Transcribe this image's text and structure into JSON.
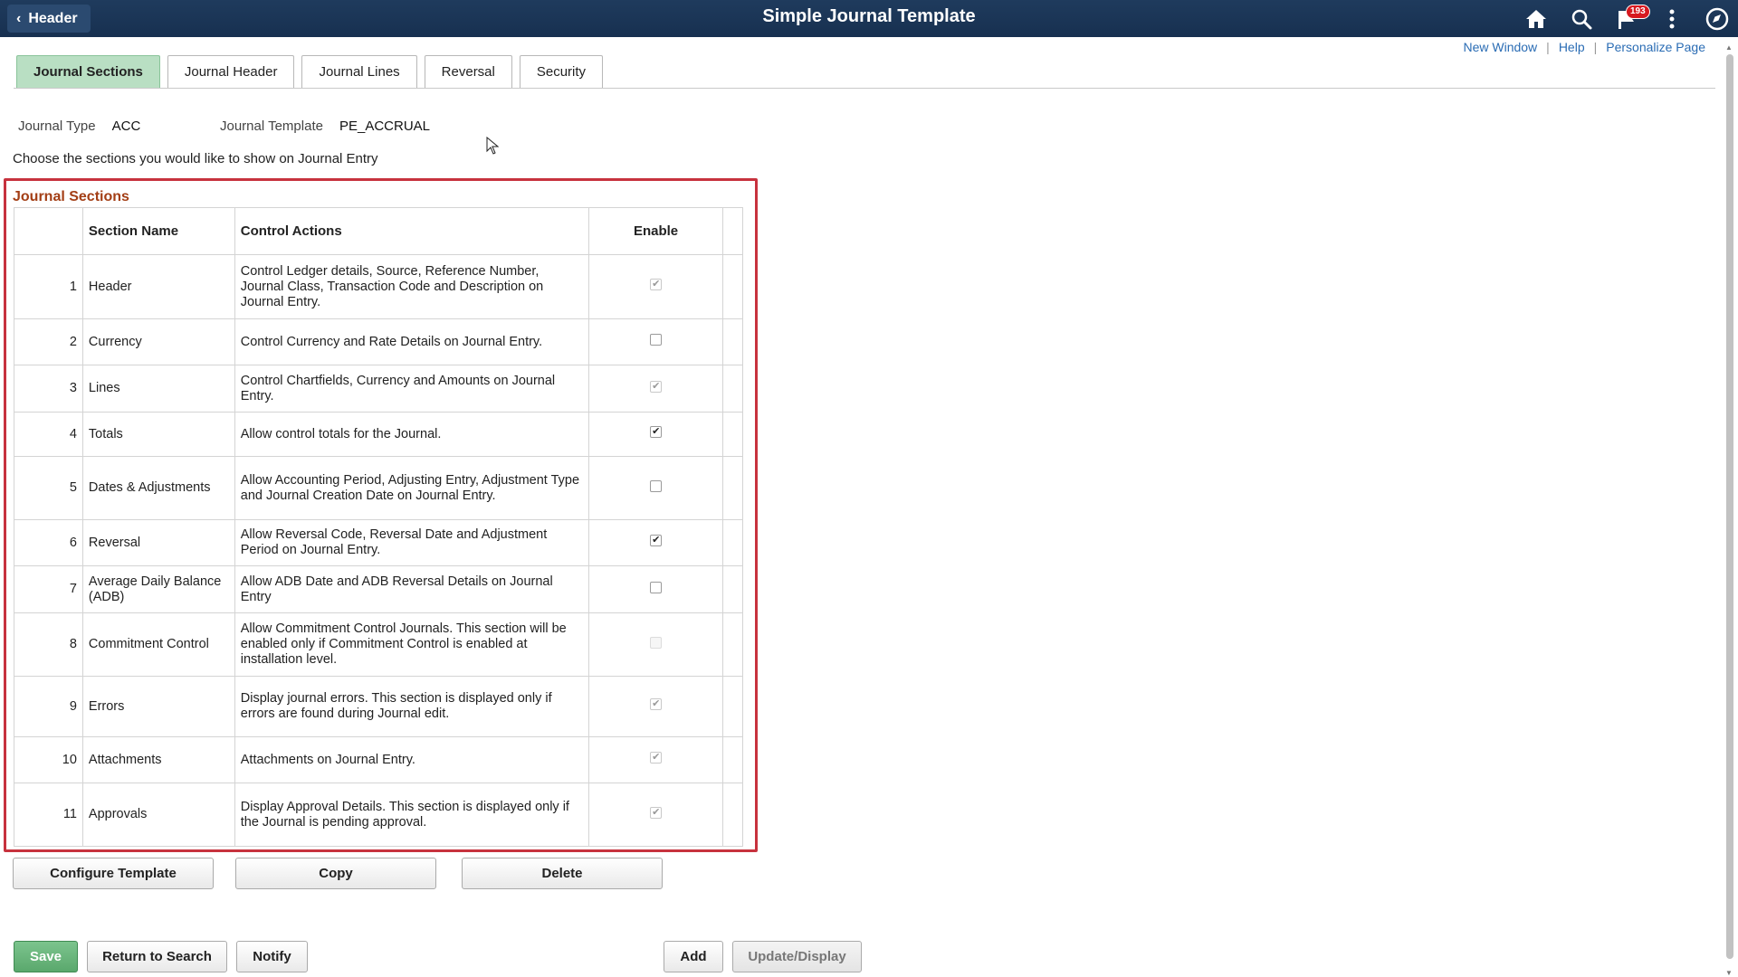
{
  "header": {
    "back_label": "Header",
    "title": "Simple Journal Template",
    "notification_count": "193",
    "icons": [
      "home-icon",
      "search-icon",
      "notifications-flag-icon",
      "actions-menu-icon",
      "navbar-compass-icon"
    ]
  },
  "top_links": {
    "new_window": "New Window",
    "help": "Help",
    "personalize": "Personalize Page",
    "separator": "|"
  },
  "tabs": [
    {
      "label": "Journal Sections",
      "active": true
    },
    {
      "label": "Journal Header",
      "active": false
    },
    {
      "label": "Journal Lines",
      "active": false
    },
    {
      "label": "Reversal",
      "active": false
    },
    {
      "label": "Security",
      "active": false
    }
  ],
  "fields": {
    "journal_type_label": "Journal Type",
    "journal_type_value": "ACC",
    "journal_template_label": "Journal Template",
    "journal_template_value": "PE_ACCRUAL"
  },
  "instruction": "Choose the sections you would like to show on Journal Entry",
  "grid": {
    "title": "Journal Sections",
    "columns": {
      "section_name": "Section Name",
      "control_actions": "Control Actions",
      "enable": "Enable"
    },
    "rows": [
      {
        "num": "1",
        "name": "Header",
        "actions": "Control Ledger details, Source, Reference Number, Journal Class, Transaction Code and Description on Journal Entry.",
        "checked": true,
        "dim": true
      },
      {
        "num": "2",
        "name": "Currency",
        "actions": "Control Currency and Rate Details on Journal Entry.",
        "checked": false,
        "dim": false
      },
      {
        "num": "3",
        "name": "Lines",
        "actions": "Control Chartfields, Currency and Amounts on Journal Entry.",
        "checked": true,
        "dim": true
      },
      {
        "num": "4",
        "name": "Totals",
        "actions": "Allow control totals for the Journal.",
        "checked": true,
        "dim": false
      },
      {
        "num": "5",
        "name": "Dates & Adjustments",
        "actions": "Allow Accounting Period, Adjusting Entry, Adjustment Type and Journal Creation Date on Journal Entry.",
        "checked": false,
        "dim": false
      },
      {
        "num": "6",
        "name": "Reversal",
        "actions": "Allow Reversal Code, Reversal Date and Adjustment Period on Journal Entry.",
        "checked": true,
        "dim": false
      },
      {
        "num": "7",
        "name": "Average Daily Balance (ADB)",
        "actions": "Allow ADB Date and ADB Reversal Details on Journal Entry",
        "checked": false,
        "dim": false
      },
      {
        "num": "8",
        "name": "Commitment Control",
        "actions": "Allow Commitment Control Journals. This section will be enabled only if Commitment Control is enabled at installation level.",
        "checked": false,
        "disabled": true
      },
      {
        "num": "9",
        "name": "Errors",
        "actions": "Display journal errors. This section is displayed only if errors are found during Journal edit.",
        "checked": true,
        "dim": true
      },
      {
        "num": "10",
        "name": "Attachments",
        "actions": "Attachments on Journal Entry.",
        "checked": true,
        "dim": true
      },
      {
        "num": "11",
        "name": "Approvals",
        "actions": "Display Approval Details. This section is displayed only if the Journal is pending approval.",
        "checked": true,
        "dim": true
      }
    ]
  },
  "grid_buttons": {
    "configure": "Configure Template",
    "copy": "Copy",
    "delete": "Delete"
  },
  "toolbar": {
    "save": "Save",
    "return_to_search": "Return to Search",
    "notify": "Notify",
    "add": "Add",
    "update_display": "Update/Display"
  },
  "colors": {
    "banner": "#1f3b5d",
    "active_tab": "#b9dfc3",
    "highlight_border": "#c7323e",
    "grid_title": "#a33e15",
    "link": "#2a6cb4",
    "save_button": "#5aa86d"
  }
}
